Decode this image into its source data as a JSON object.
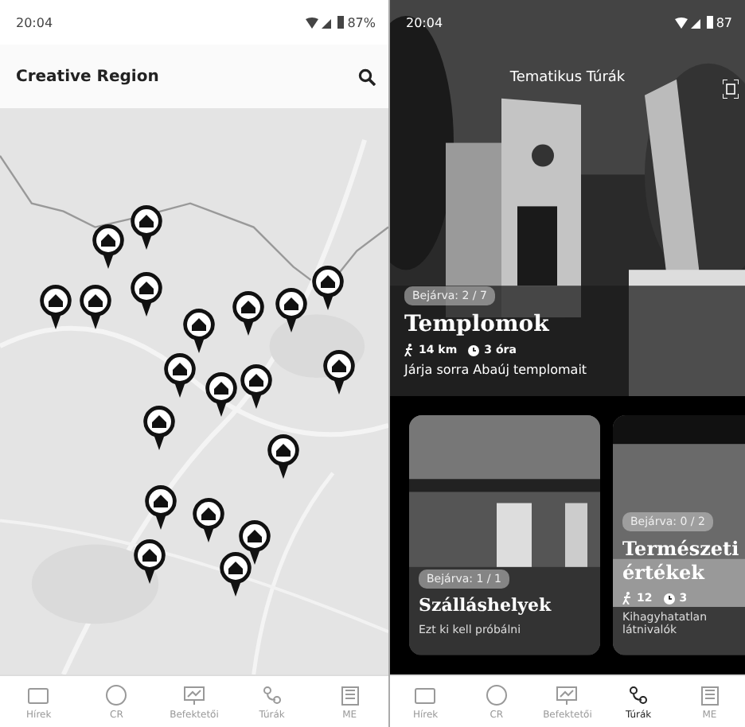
{
  "screens": [
    {
      "kind": "map",
      "status_bar": {
        "time": "20:04",
        "battery": "87%"
      },
      "title": "Creative Region",
      "nav": [
        {
          "label": "Hírek",
          "selected": false
        },
        {
          "label": "CR",
          "selected": false
        },
        {
          "label": "Befektetői",
          "selected": false
        },
        {
          "label": "Túrák",
          "selected": false
        },
        {
          "label": "ME",
          "selected": false
        }
      ]
    },
    {
      "kind": "tours",
      "status_bar": {
        "time": "20:04",
        "battery": "87"
      },
      "title": "Tematikus Túrák",
      "featured": {
        "badge": "Bejárva: 2 / 7",
        "title": "Templomok",
        "distance": "14 km",
        "duration": "3 óra",
        "description": "Járja sorra Abaúj templomait"
      },
      "cards": [
        {
          "badge": "Bejárva: 1 / 1",
          "title": "Szálláshelyek",
          "description": "Ezt ki kell próbálni"
        },
        {
          "badge": "Bejárva: 0 / 2",
          "title": "Természeti értékek",
          "distance": "12",
          "duration": "3",
          "description": "Kihagyhatatlan látnivalók"
        }
      ],
      "nav": [
        {
          "label": "Hírek",
          "selected": false
        },
        {
          "label": "CR",
          "selected": false
        },
        {
          "label": "Befektetői",
          "selected": false
        },
        {
          "label": "Túrák",
          "selected": true
        },
        {
          "label": "ME",
          "selected": false
        }
      ]
    }
  ]
}
